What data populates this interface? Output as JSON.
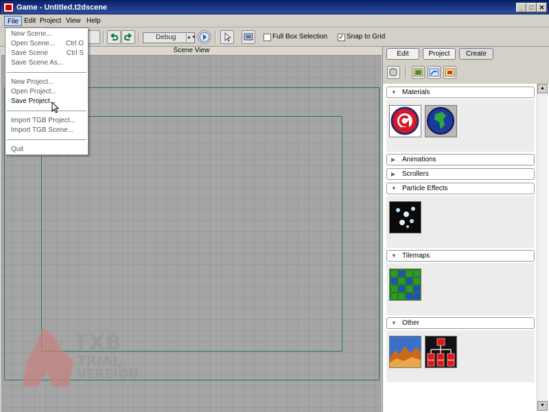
{
  "window": {
    "title": "Game - Untitled.t2dscene",
    "min": "_",
    "max": "□",
    "close": "✕"
  },
  "menubar": {
    "items": [
      "File",
      "Edit",
      "Project",
      "View",
      "Help"
    ]
  },
  "file_menu": {
    "items": [
      {
        "label": "New Scene...",
        "shortcut": ""
      },
      {
        "label": "Open Scene...",
        "shortcut": "Ctrl O"
      },
      {
        "label": "Save Scene",
        "shortcut": "Ctrl S"
      },
      {
        "label": "Save Scene As...",
        "shortcut": ""
      },
      {
        "label": "New Project...",
        "shortcut": ""
      },
      {
        "label": "Open Project...",
        "shortcut": ""
      },
      {
        "label": "Save Project...",
        "shortcut": ""
      },
      {
        "label": "Import TGB Project...",
        "shortcut": ""
      },
      {
        "label": "Import TGB Scene...",
        "shortcut": ""
      },
      {
        "label": "Quit",
        "shortcut": ""
      }
    ]
  },
  "toolbar": {
    "config_value": "Debug",
    "full_box_label": "Full Box Selection",
    "full_box_checked": false,
    "snap_label": "Snap to Grid",
    "snap_checked": true,
    "check_mark": "✓"
  },
  "scene": {
    "header": "Scene View"
  },
  "watermark": {
    "line1": "TXB",
    "line2": "TRIAL",
    "line3": "VERSION"
  },
  "right_panel": {
    "tabs": [
      "Edit",
      "Project",
      "Create"
    ],
    "active_tab": "Create",
    "sections": [
      {
        "label": "Materials",
        "expanded": true
      },
      {
        "label": "Animations",
        "expanded": false
      },
      {
        "label": "Scrollers",
        "expanded": false
      },
      {
        "label": "Particle Effects",
        "expanded": true
      },
      {
        "label": "Tilemaps",
        "expanded": true
      },
      {
        "label": "Other",
        "expanded": true
      }
    ],
    "expanded_glyph": "▼",
    "collapsed_glyph": "▶"
  },
  "colors": {
    "title_bar": "#0a246a",
    "grid": "#a5a5a5",
    "camera_border": "#1a7a50"
  }
}
